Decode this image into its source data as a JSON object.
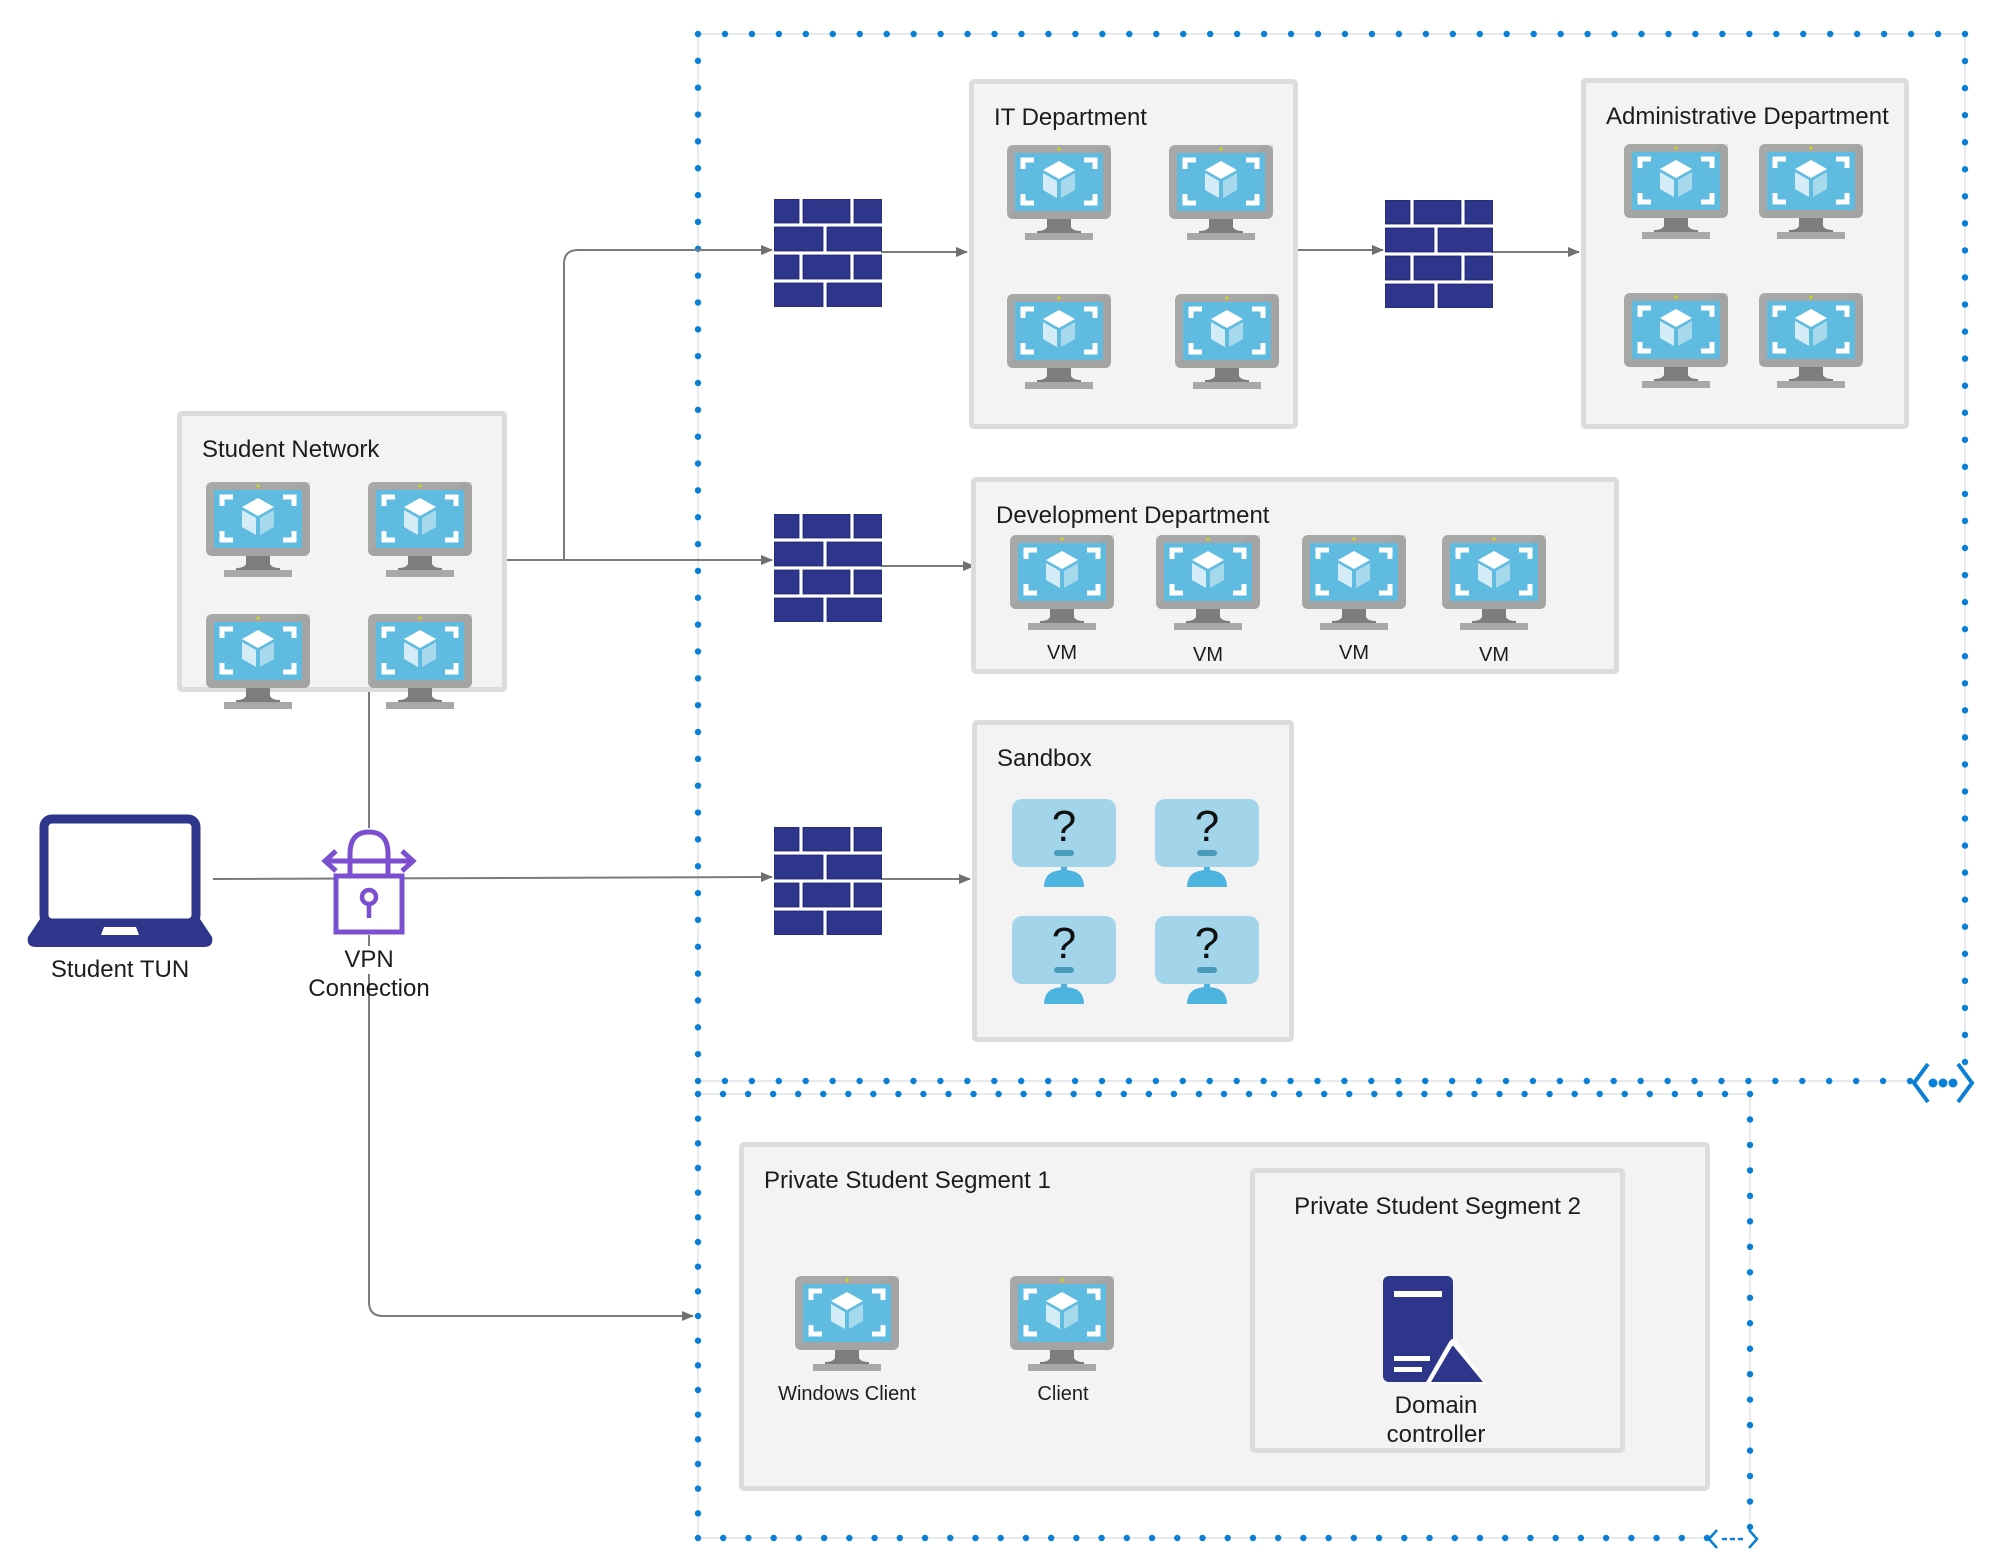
{
  "diagram": {
    "colors": {
      "vnet_dots": "#0a7fd6",
      "connector": "#7a7a7a",
      "firewall": "#2e368b",
      "group_fill": "#f3f3f3",
      "group_border": "#dcdcdc",
      "vm_screen": "#5fbbe0",
      "vm_frame": "#a8a8a8",
      "vpn": "#7b4fd0",
      "laptop": "#2e368b",
      "unknown_screen": "#a3d5ea",
      "unknown_stand": "#4db4e0"
    },
    "student_network": {
      "title": "Student Network",
      "vms": [
        "vm",
        "vm",
        "vm",
        "vm"
      ]
    },
    "student_tun": {
      "label": "Student TUN",
      "icon": "laptop-icon"
    },
    "vpn": {
      "label_line1": "VPN",
      "label_line2": "Connection",
      "icon": "vpn-lock-icon"
    },
    "it_department": {
      "title": "IT Department",
      "vms": [
        "vm",
        "vm",
        "vm",
        "vm"
      ]
    },
    "administrative_department": {
      "title": "Administrative Department",
      "vms": [
        "vm",
        "vm",
        "vm",
        "vm"
      ]
    },
    "development_department": {
      "title": "Development Department",
      "vms": [
        {
          "label": "VM"
        },
        {
          "label": "VM"
        },
        {
          "label": "VM"
        },
        {
          "label": "VM"
        }
      ]
    },
    "sandbox": {
      "title": "Sandbox",
      "unknown_hosts": [
        "?",
        "?",
        "?",
        "?"
      ]
    },
    "private_segment_1": {
      "title": "Private Student Segment 1",
      "hosts": [
        {
          "label": "Windows Client"
        },
        {
          "label": "Client"
        }
      ]
    },
    "private_segment_2": {
      "title": "Private Student Segment 2",
      "domain_controller": {
        "label_line1": "Domain",
        "label_line2": "controller"
      }
    },
    "firewalls": [
      "firewall-it",
      "firewall-dev",
      "firewall-sandbox",
      "firewall-admin"
    ],
    "vnets": [
      "virtual-network-main",
      "virtual-network-private"
    ]
  }
}
